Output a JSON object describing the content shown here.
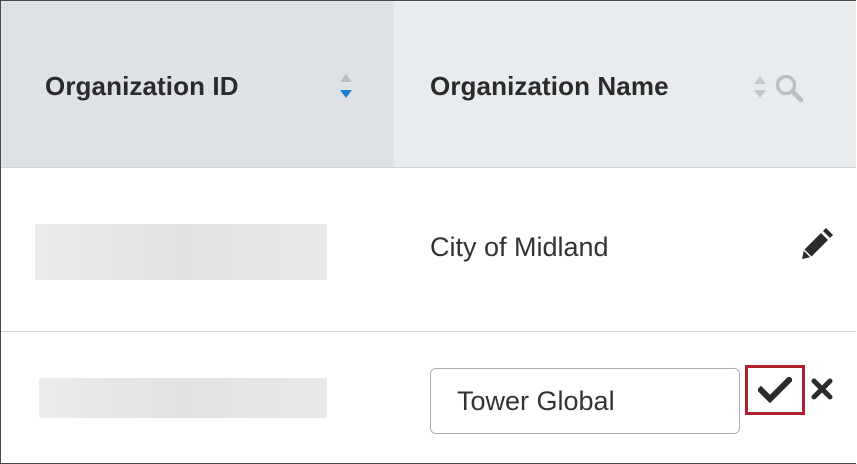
{
  "table": {
    "columns": [
      {
        "label": "Organization ID",
        "sort_icon": "sort-both-icon",
        "sort_active": "descending"
      },
      {
        "label": "Organization Name",
        "sort_icon": "sort-both-icon",
        "filter_icon": "search-icon"
      }
    ],
    "rows": [
      {
        "org_id": "",
        "org_id_redacted": true,
        "org_name": "City of Midland",
        "action_icon": "pencil-icon"
      },
      {
        "org_id": "",
        "org_id_redacted": true,
        "org_name_input_value": "Tower Global",
        "actions": [
          "checkmark-icon",
          "close-icon"
        ],
        "highlighted_action": "checkmark-icon"
      }
    ]
  },
  "colors": {
    "header_bg": "#e9ecef",
    "sorted_header_bg": "#dee2e6",
    "sort_active_color": "#1e7fc6",
    "highlight_border": "#b1202e",
    "icon_dark": "#2b2b2b"
  }
}
